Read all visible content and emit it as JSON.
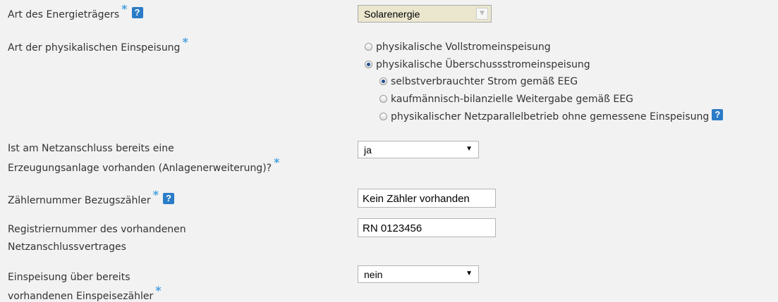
{
  "fields": {
    "energy_type": {
      "label": "Art des Energieträgers",
      "value": "Solarenergie"
    },
    "feed_in": {
      "label": "Art der physikalischen Einspeisung",
      "options": [
        "physikalische Vollstromeinspeisung",
        "physikalische Überschussstromeinspeisung"
      ],
      "sub_options": [
        "selbstverbrauchter Strom gemäß EEG",
        "kaufmännisch-bilanzielle Weitergabe gemäß EEG",
        "physikalischer Netzparallelbetrieb ohne gemessene Einspeisung"
      ]
    },
    "existing_plant": {
      "label_line1": "Ist am Netzanschluss bereits eine",
      "label_line2": "Erzeugungsanlage vorhanden (Anlagenerweiterung)?",
      "value": "ja"
    },
    "meter_number": {
      "label": "Zählernummer Bezugszähler",
      "value": "Kein Zähler vorhanden"
    },
    "registration_number": {
      "label_line1": "Registriernummer des vorhandenen",
      "label_line2": "Netzanschlussvertrages",
      "value": "RN 0123456"
    },
    "existing_meter": {
      "label_line1": "Einspeisung über bereits",
      "label_line2": "vorhandenen Einspeisezähler",
      "value": "nein"
    }
  },
  "symbols": {
    "required_marker": "*",
    "help_icon_text": "?"
  },
  "colors": {
    "required": "#4aa3df",
    "help": "#2a7cc7",
    "readonly_select_bg": "#ebe7cf",
    "page_bg": "#f2f2f2"
  }
}
